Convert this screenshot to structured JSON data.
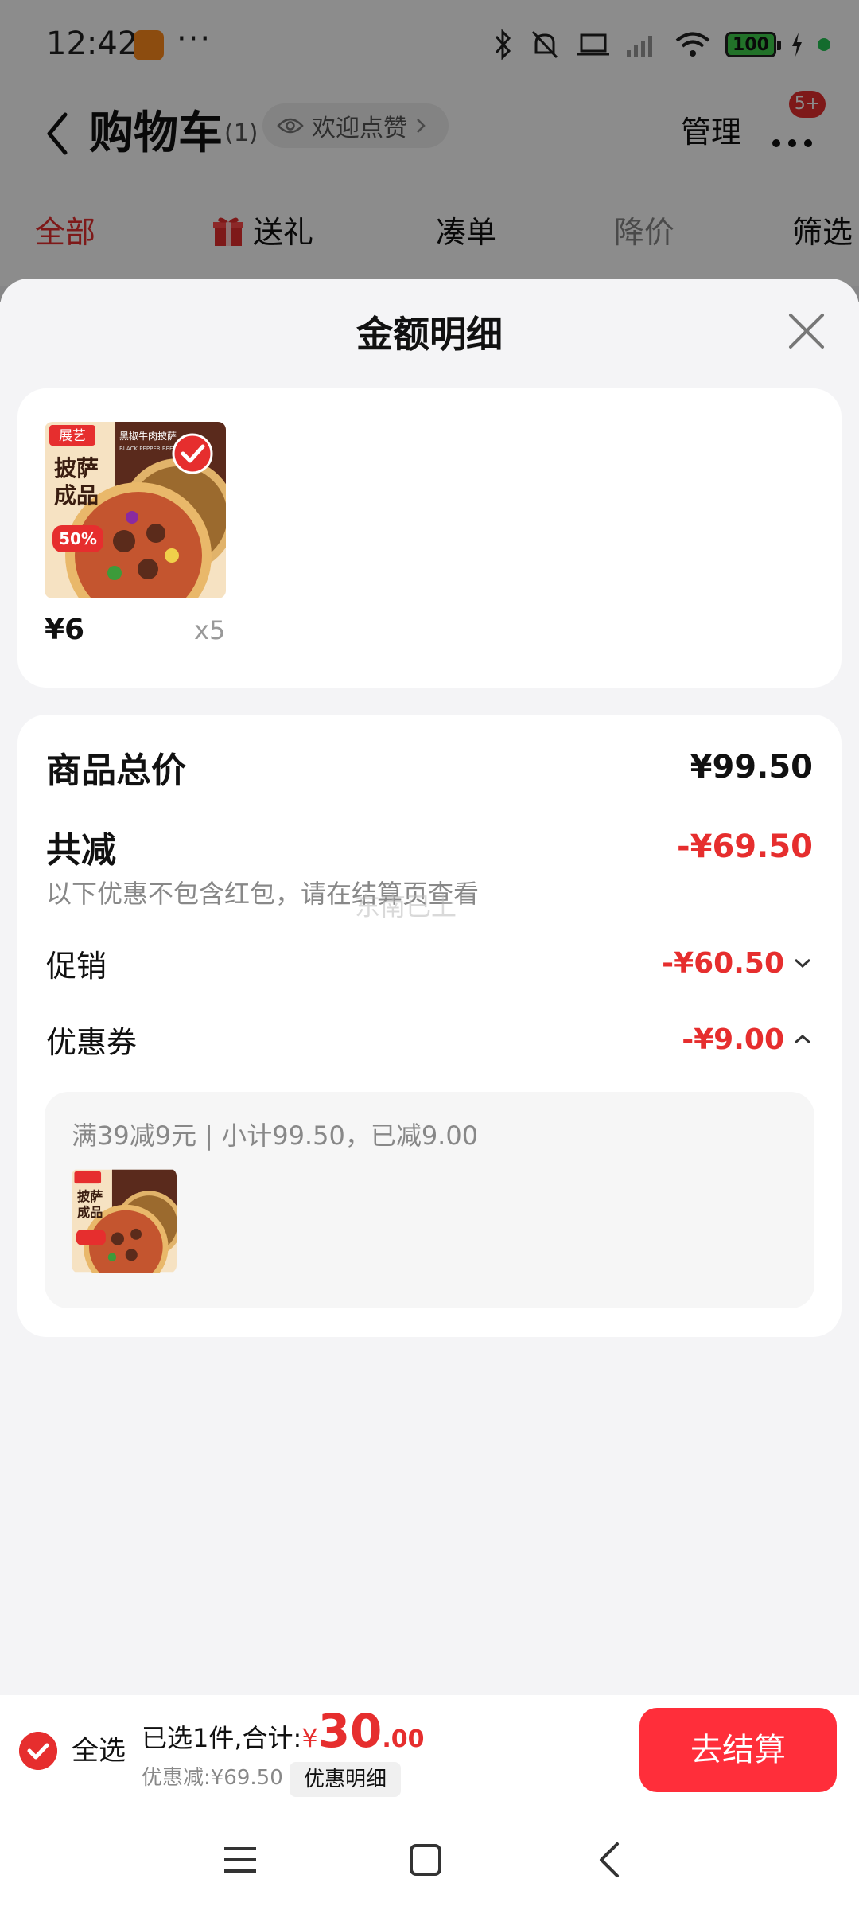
{
  "status_bar": {
    "time": "12:42",
    "dots": "···",
    "battery": "100"
  },
  "nav": {
    "title": "购物车",
    "count": "(1)",
    "like_pill": "欢迎点赞",
    "manage": "管理",
    "more_badge": "5+"
  },
  "filter_tabs": [
    {
      "label": "全部",
      "state": "active"
    },
    {
      "label": "送礼",
      "state": "normal"
    },
    {
      "label": "凑单",
      "state": "normal"
    },
    {
      "label": "降价",
      "state": "muted"
    },
    {
      "label": "筛选",
      "state": "normal"
    }
  ],
  "sheet": {
    "title": "金额明细",
    "product": {
      "price": "¥6",
      "qty": "x5",
      "image": {
        "brand": "展艺",
        "headline": "披萨成品",
        "subhead": "黑椒牛肉披萨",
        "subhead_en": "BLACK PEPPER BEEF PIZZA",
        "percent": "50%"
      }
    },
    "summary": {
      "total_label": "商品总价",
      "total_value": "¥99.50",
      "reduce_label": "共减",
      "reduce_value": "-¥69.50",
      "note": "以下优惠不包含红包，请在结算页查看",
      "watermark": "东南已上",
      "promo_label": "促销",
      "promo_value": "-¥60.50",
      "coupon_label": "优惠券",
      "coupon_value": "-¥9.00",
      "coupon_detail": "满39减9元 | 小计99.50，已减9.00"
    }
  },
  "checkout": {
    "select_all": "全选",
    "selected_prefix": "已选1件,合计:",
    "yen": "¥",
    "total_int": "30",
    "total_dec": ".00",
    "discount": "优惠减:¥69.50",
    "detail_button": "优惠明细",
    "checkout_button": "去结算"
  },
  "colors": {
    "accent": "#e62e2e",
    "checkout_button": "#ff2e3a",
    "sheet_bg": "#f4f4f6"
  }
}
